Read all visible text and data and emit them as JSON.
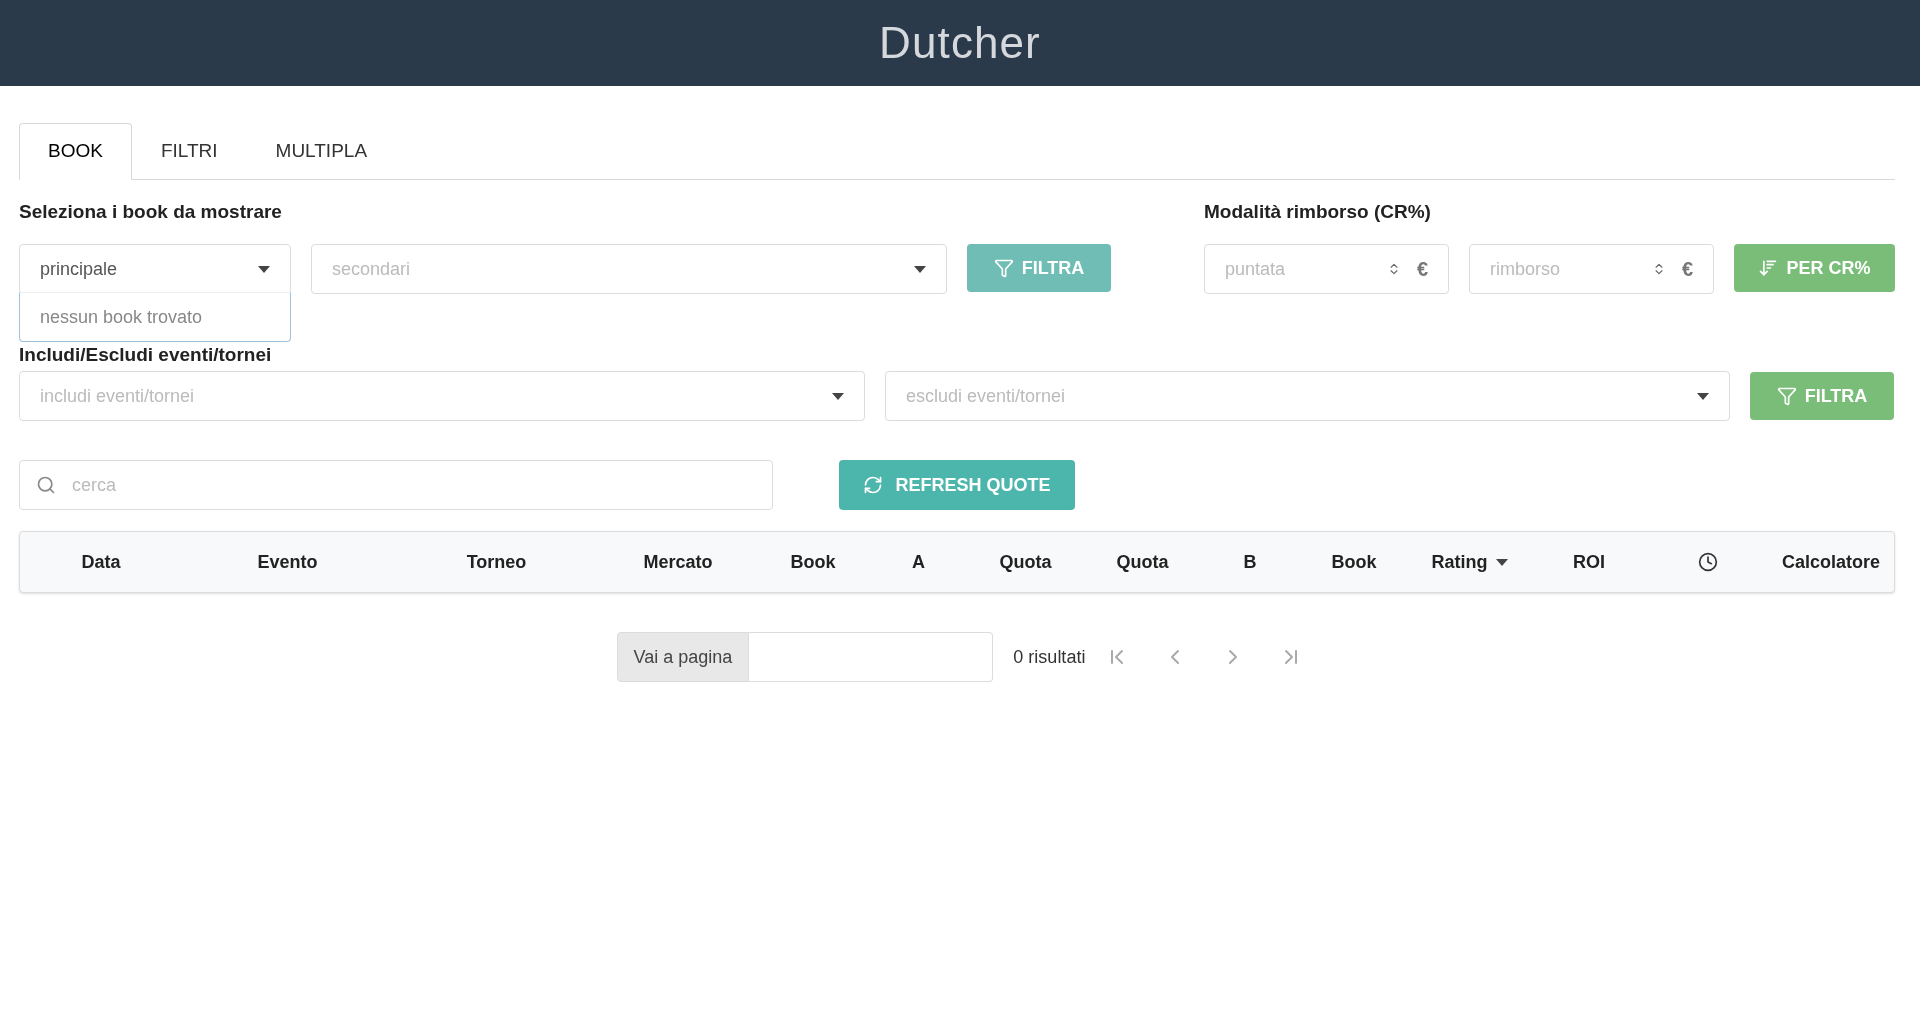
{
  "header": {
    "title": "Dutcher"
  },
  "tabs": [
    {
      "label": "BOOK",
      "selected": true
    },
    {
      "label": "FILTRI",
      "selected": false
    },
    {
      "label": "MULTIPLA",
      "selected": false
    }
  ],
  "books": {
    "label": "Seleziona i book da mostrare",
    "main_select": {
      "value": "principale",
      "expanded": true,
      "options_message": "nessun book trovato"
    },
    "secondary_select": {
      "placeholder": "secondari"
    },
    "filter_button": {
      "label": "FILTRA",
      "disabled": true
    }
  },
  "refund": {
    "label": "Modalità rimborso (CR%)",
    "stake_field": {
      "placeholder": "puntata",
      "unit": "€"
    },
    "refund_field": {
      "placeholder": "rimborso",
      "unit": "€"
    },
    "sort_button": {
      "label": "PER CR%",
      "disabled": true
    }
  },
  "events": {
    "label": "Includi/Escludi eventi/tornei",
    "include_select": {
      "placeholder": "includi eventi/tornei"
    },
    "exclude_select": {
      "placeholder": "escludi eventi/tornei"
    },
    "filter_button": {
      "label": "FILTRA",
      "disabled": true
    }
  },
  "search": {
    "placeholder": "cerca"
  },
  "refresh_button": {
    "label": "REFRESH QUOTE",
    "disabled": false
  },
  "table": {
    "columns": [
      {
        "kind": "text",
        "label": "Data"
      },
      {
        "kind": "text",
        "label": "Evento"
      },
      {
        "kind": "text",
        "label": "Torneo"
      },
      {
        "kind": "text",
        "label": "Mercato"
      },
      {
        "kind": "text",
        "label": "Book"
      },
      {
        "kind": "text",
        "label": "A"
      },
      {
        "kind": "text",
        "label": "Quota"
      },
      {
        "kind": "text",
        "label": "Quota"
      },
      {
        "kind": "text",
        "label": "B"
      },
      {
        "kind": "text",
        "label": "Book"
      },
      {
        "kind": "sorted",
        "label": "Rating"
      },
      {
        "kind": "text",
        "label": "ROI"
      },
      {
        "kind": "clock"
      },
      {
        "kind": "text",
        "label": "Calcolatore"
      }
    ]
  },
  "pagination": {
    "goto_label": "Vai a pagina",
    "results": "0 risultati"
  }
}
